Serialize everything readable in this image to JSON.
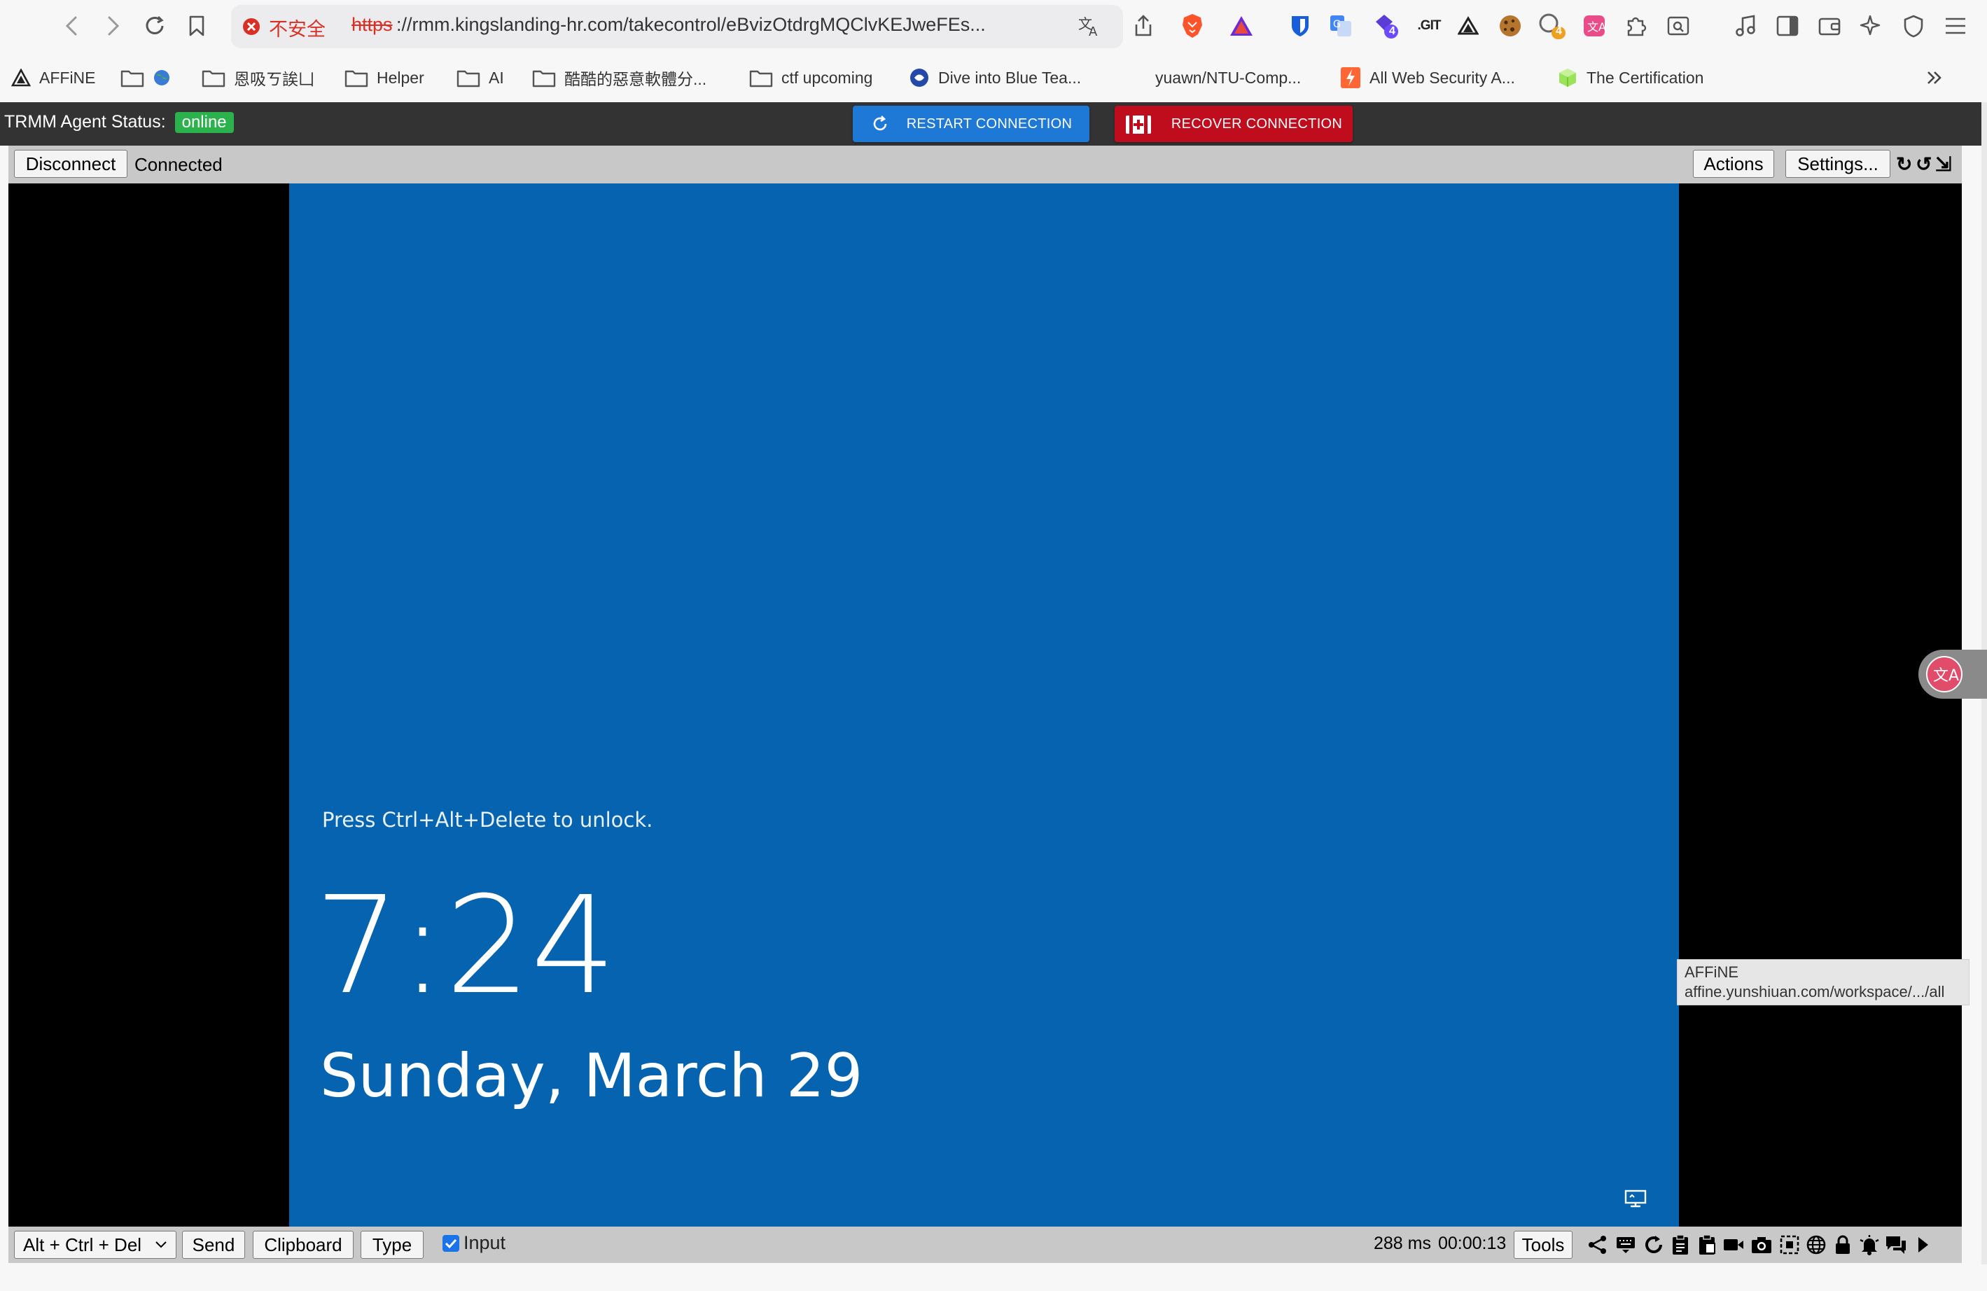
{
  "browser": {
    "insecure_label": "不安全",
    "url_scheme": "https",
    "url_rest": "://rmm.kingslanding-hr.com/takecontrol/eBvizOtdrgMQClvKEJweFEs...",
    "ext_badges": {
      "proton": "4",
      "ghost": "4"
    },
    "git_label": ".GIT"
  },
  "bookmarks": [
    {
      "label": "AFFiNE",
      "icon": "affine-icon"
    },
    {
      "label": "",
      "icon": "folder-globe-icon"
    },
    {
      "label": "恩吸ㄎ誒凵",
      "icon": "folder-icon"
    },
    {
      "label": "Helper",
      "icon": "folder-icon"
    },
    {
      "label": "AI",
      "icon": "folder-icon"
    },
    {
      "label": "酷酷的惡意軟體分...",
      "icon": "folder-icon"
    },
    {
      "label": "ctf upcoming",
      "icon": "folder-icon"
    },
    {
      "label": "Dive into Blue Tea...",
      "icon": "blue-team-icon"
    },
    {
      "label": "yuawn/NTU-Comp...",
      "icon": "github-icon"
    },
    {
      "label": "All Web Security A...",
      "icon": "portswigger-icon"
    },
    {
      "label": "The Certification",
      "icon": "cube-icon"
    }
  ],
  "trmm": {
    "status_label": "TRMM Agent Status:",
    "status_value": "online",
    "restart_label": "RESTART CONNECTION",
    "recover_label": "RECOVER CONNECTION",
    "colors": {
      "restart": "#1e78d6",
      "recover": "#c00d1e",
      "online": "#2bb24c"
    }
  },
  "mesh_top": {
    "disconnect_label": "Disconnect",
    "connection_state": "Connected",
    "actions_label": "Actions",
    "settings_label": "Settings...",
    "rotate_cw": "↻",
    "rotate_ccw": "↺",
    "fit_glyph": "⇲"
  },
  "lockscreen": {
    "hint": "Press Ctrl+Alt+Delete to unlock.",
    "time": "7:24",
    "date": "Sunday, March 29",
    "bg_color": "#0563b0"
  },
  "mesh_bottom": {
    "key_combo_selected": "Alt + Ctrl + Del",
    "send_label": "Send",
    "clipboard_label": "Clipboard",
    "type_label": "Type",
    "input_label": "Input",
    "input_checked": true,
    "latency": "288 ms",
    "session_time": "00:00:13",
    "tools_label": "Tools"
  },
  "tooltip": {
    "title": "AFFiNE",
    "url": "affine.yunshiuan.com/workspace/.../all"
  }
}
